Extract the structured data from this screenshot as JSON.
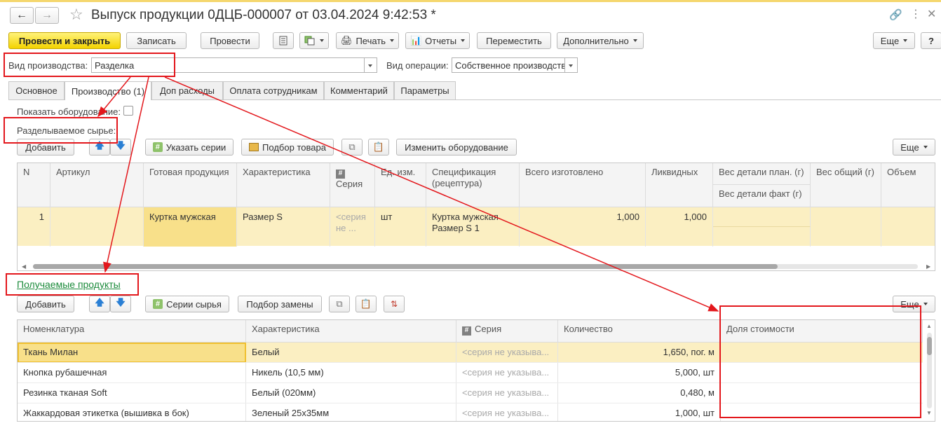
{
  "window": {
    "title": "Выпуск продукции 0ДЦБ-000007 от 03.04.2024 9:42:53 *"
  },
  "toolbar": {
    "post_close": "Провести и закрыть",
    "save": "Записать",
    "post": "Провести",
    "print": "Печать",
    "reports": "Отчеты",
    "move": "Переместить",
    "more": "Дополнительно",
    "more_right": "Еще"
  },
  "fields": {
    "production_type_label": "Вид производства:",
    "production_type_value": "Разделка",
    "operation_type_label": "Вид операции:",
    "operation_type_value": "Собственное производство"
  },
  "tabs": [
    {
      "label": "Основное"
    },
    {
      "label": "Производство (1)"
    },
    {
      "label": "Доп расходы"
    },
    {
      "label": "Оплата сотрудникам"
    },
    {
      "label": "Комментарий"
    },
    {
      "label": "Параметры"
    }
  ],
  "raw_section": {
    "show_equipment_label": "Показать оборудование:",
    "title": "Разделываемое сырье:",
    "add": "Добавить",
    "set_series": "Указать серии",
    "pick_goods": "Подбор товара",
    "change_equipment": "Изменить оборудование",
    "more": "Еще",
    "columns": [
      "N",
      "Артикул",
      "Готовая продукция",
      "Характеристика",
      "Серия",
      "Ед. изм.",
      "Спецификация (рецептура)",
      "Всего изготовлено",
      "Ликвидных",
      "Вес детали план. (г)",
      "Вес детали факт (г)",
      "Вес общий (г)",
      "Объем"
    ],
    "rows": [
      {
        "n": "1",
        "article": "",
        "product": "Куртка мужская",
        "characteristic": "Размер S",
        "series": "<серия не ...",
        "unit": "шт",
        "spec": "Куртка мужская Размер S 1",
        "total": "1,000",
        "liquid": "1,000"
      }
    ]
  },
  "products_section": {
    "title": "Получаемые продукты",
    "add": "Добавить",
    "raw_series": "Серии сырья",
    "pick_replacement": "Подбор замены",
    "more": "Еще",
    "columns": [
      "Номенклатура",
      "Характеристика",
      "Серия",
      "Количество",
      "Доля стоимости"
    ],
    "rows": [
      {
        "name": "Ткань Милан",
        "characteristic": "Белый",
        "series": "<серия не указыва...",
        "qty": "1,650, пог. м",
        "share": ""
      },
      {
        "name": "Кнопка рубашечная",
        "characteristic": "Никель (10,5 мм)",
        "series": "<серия не указыва...",
        "qty": "5,000, шт",
        "share": ""
      },
      {
        "name": "Резинка тканая Soft",
        "characteristic": "Белый (020мм)",
        "series": "<серия не указыва...",
        "qty": "0,480, м",
        "share": ""
      },
      {
        "name": "Жаккардовая этикетка (вышивка в бок)",
        "characteristic": "Зеленый 25x35мм",
        "series": "<серия не указыва...",
        "qty": "1,000, шт",
        "share": ""
      }
    ]
  },
  "colors": {
    "accent_yellow": "#f3d300",
    "highlight_row": "#fbefc2",
    "annotation_red": "#e3171c",
    "link_green": "#1a8a3a"
  }
}
